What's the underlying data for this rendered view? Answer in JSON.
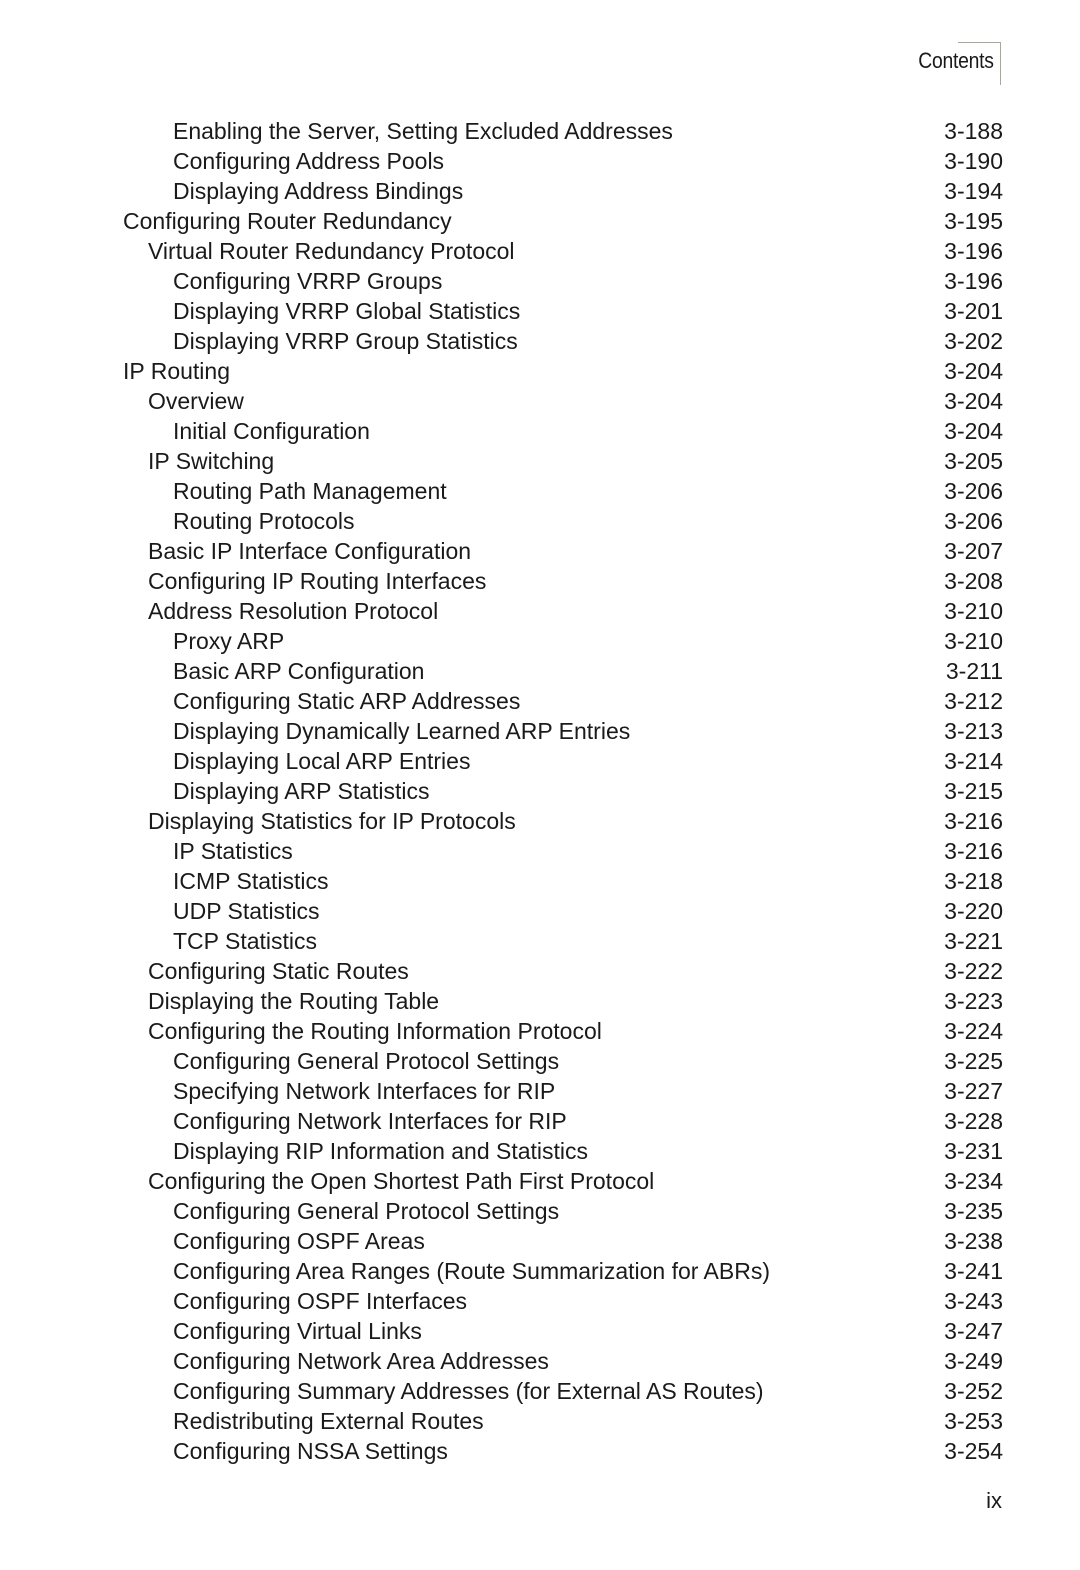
{
  "header": {
    "section_label": "Contents"
  },
  "toc_entries": [
    {
      "level": 3,
      "title": "Enabling the Server, Setting Excluded Addresses",
      "page": "3-188"
    },
    {
      "level": 3,
      "title": "Configuring Address Pools",
      "page": "3-190"
    },
    {
      "level": 3,
      "title": "Displaying Address Bindings",
      "page": "3-194"
    },
    {
      "level": 1,
      "title": "Configuring Router Redundancy",
      "page": "3-195"
    },
    {
      "level": 2,
      "title": "Virtual Router Redundancy Protocol",
      "page": "3-196"
    },
    {
      "level": 3,
      "title": "Configuring VRRP Groups",
      "page": "3-196"
    },
    {
      "level": 3,
      "title": "Displaying VRRP Global Statistics",
      "page": "3-201"
    },
    {
      "level": 3,
      "title": "Displaying VRRP Group Statistics",
      "page": "3-202"
    },
    {
      "level": 1,
      "title": "IP Routing",
      "page": "3-204"
    },
    {
      "level": 2,
      "title": "Overview",
      "page": "3-204"
    },
    {
      "level": 3,
      "title": "Initial Configuration",
      "page": "3-204"
    },
    {
      "level": 2,
      "title": "IP Switching",
      "page": "3-205"
    },
    {
      "level": 3,
      "title": "Routing Path Management",
      "page": "3-206"
    },
    {
      "level": 3,
      "title": "Routing Protocols",
      "page": "3-206"
    },
    {
      "level": 2,
      "title": "Basic IP Interface Configuration",
      "page": "3-207"
    },
    {
      "level": 2,
      "title": "Configuring IP Routing Interfaces",
      "page": "3-208"
    },
    {
      "level": 2,
      "title": "Address Resolution Protocol",
      "page": "3-210"
    },
    {
      "level": 3,
      "title": "Proxy ARP",
      "page": "3-210"
    },
    {
      "level": 3,
      "title": "Basic ARP Configuration",
      "page": "3-211"
    },
    {
      "level": 3,
      "title": "Configuring Static ARP Addresses",
      "page": "3-212"
    },
    {
      "level": 3,
      "title": "Displaying Dynamically Learned ARP Entries",
      "page": "3-213"
    },
    {
      "level": 3,
      "title": "Displaying Local ARP Entries",
      "page": "3-214"
    },
    {
      "level": 3,
      "title": "Displaying ARP Statistics",
      "page": "3-215"
    },
    {
      "level": 2,
      "title": "Displaying Statistics for IP Protocols",
      "page": "3-216"
    },
    {
      "level": 3,
      "title": "IP Statistics",
      "page": "3-216"
    },
    {
      "level": 3,
      "title": "ICMP Statistics",
      "page": "3-218"
    },
    {
      "level": 3,
      "title": "UDP Statistics",
      "page": "3-220"
    },
    {
      "level": 3,
      "title": "TCP Statistics",
      "page": "3-221"
    },
    {
      "level": 2,
      "title": "Configuring Static Routes",
      "page": "3-222"
    },
    {
      "level": 2,
      "title": "Displaying the Routing Table",
      "page": "3-223"
    },
    {
      "level": 2,
      "title": "Configuring the Routing Information Protocol",
      "page": "3-224"
    },
    {
      "level": 3,
      "title": "Configuring General Protocol Settings",
      "page": "3-225"
    },
    {
      "level": 3,
      "title": "Specifying Network Interfaces for RIP",
      "page": "3-227"
    },
    {
      "level": 3,
      "title": "Configuring Network Interfaces for RIP",
      "page": "3-228"
    },
    {
      "level": 3,
      "title": "Displaying RIP Information and Statistics",
      "page": "3-231"
    },
    {
      "level": 2,
      "title": "Configuring the Open Shortest Path First Protocol",
      "page": "3-234"
    },
    {
      "level": 3,
      "title": "Configuring General Protocol Settings",
      "page": "3-235"
    },
    {
      "level": 3,
      "title": "Configuring OSPF Areas",
      "page": "3-238"
    },
    {
      "level": 3,
      "title": "Configuring Area Ranges (Route Summarization for ABRs)",
      "page": "3-241"
    },
    {
      "level": 3,
      "title": "Configuring OSPF Interfaces",
      "page": "3-243"
    },
    {
      "level": 3,
      "title": "Configuring Virtual Links",
      "page": "3-247"
    },
    {
      "level": 3,
      "title": "Configuring Network Area Addresses",
      "page": "3-249"
    },
    {
      "level": 3,
      "title": "Configuring Summary Addresses (for External AS Routes)",
      "page": "3-252"
    },
    {
      "level": 3,
      "title": "Redistributing External Routes",
      "page": "3-253"
    },
    {
      "level": 3,
      "title": "Configuring NSSA Settings",
      "page": "3-254"
    }
  ],
  "footer": {
    "page_number": "ix"
  }
}
